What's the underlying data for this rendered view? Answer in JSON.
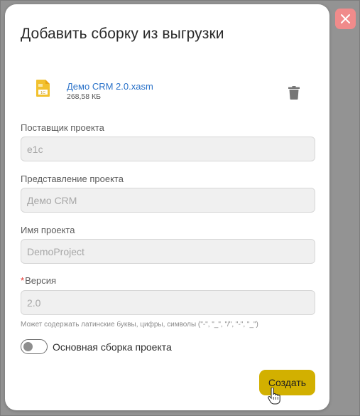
{
  "dialog": {
    "title": "Добавить сборку из выгрузки",
    "close_icon": "close-icon"
  },
  "file": {
    "name": "Демо CRM 2.0.xasm",
    "size": "268,58 КБ",
    "icon": "file-1c-icon",
    "icon_caption": "1C",
    "delete_icon": "trash-icon"
  },
  "fields": {
    "vendor": {
      "label": "Поставщик проекта",
      "value": "e1c"
    },
    "presentation": {
      "label": "Представление проекта",
      "value": "Демо CRM"
    },
    "name": {
      "label": "Имя проекта",
      "value": "DemoProject"
    },
    "version": {
      "required_mark": "*",
      "label": "Версия",
      "value": "2.0",
      "hint": "Может содержать латинские буквы, цифры, символы (\"-\", \"_\", \"/\", \"-\", \"_\")"
    }
  },
  "toggle": {
    "label": "Основная сборка проекта",
    "checked": false
  },
  "actions": {
    "create_label": "Создать"
  },
  "colors": {
    "overlay": "#939393",
    "close_button": "#f08b8b",
    "link": "#2a72c9",
    "primary_button": "#d2b000",
    "required": "#e5322d"
  }
}
